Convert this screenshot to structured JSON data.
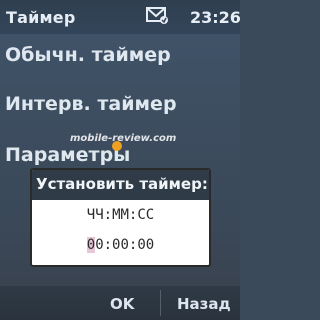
{
  "status_bar": {
    "title": "Таймер",
    "time": "23:26",
    "message_icon": "envelope-icon"
  },
  "menu": {
    "items": [
      {
        "label": "Обычн. таймер"
      },
      {
        "label": "Интерв. таймер"
      },
      {
        "label": "Параметры"
      }
    ]
  },
  "watermark": {
    "text": "mobile-review.com"
  },
  "dialog": {
    "title": "Установить таймер:",
    "format": "ЧЧ:ММ:СС",
    "value_first_char": "0",
    "value_rest": "0:00:00"
  },
  "softkeys": {
    "left": "",
    "middle": "OK",
    "right": "Назад"
  },
  "colors": {
    "background": "#3d4d5f",
    "header": "#2f3c48",
    "dialog_bg": "#ffffff",
    "cursor_highlight": "#e7c6d6"
  }
}
